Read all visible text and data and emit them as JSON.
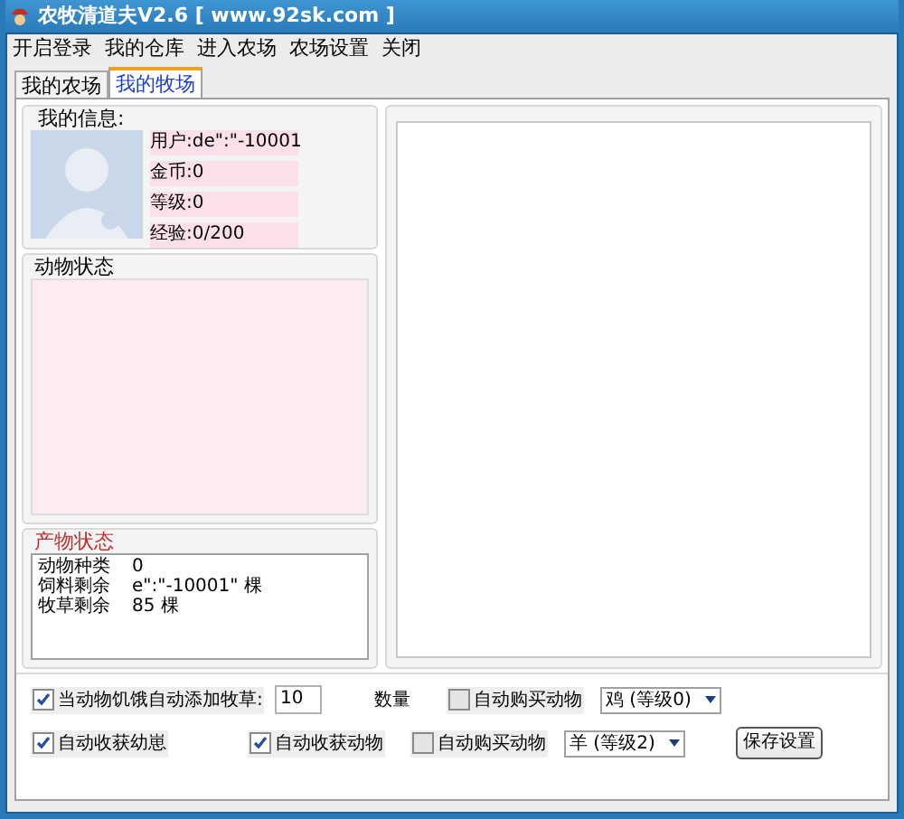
{
  "window": {
    "title": "农牧清道夫V2.6 [ www.92sk.com ]"
  },
  "menu": [
    "开启登录",
    "我的仓库",
    "进入农场",
    "农场设置",
    "关闭"
  ],
  "tabs": [
    {
      "label": "我的农场",
      "selected": false
    },
    {
      "label": "我的牧场",
      "selected": true
    }
  ],
  "my_info": {
    "title": "我的信息:",
    "fields": [
      "用户:de\":\"-10001",
      "金币:0",
      "等级:0",
      "经验:0/200"
    ]
  },
  "animal_status": {
    "title": "动物状态"
  },
  "product_status": {
    "title": "产物状态",
    "rows": [
      {
        "label": "动物种类",
        "value": "0"
      },
      {
        "label": "饲料剩余",
        "value": "e\":\"-10001\" 棵"
      },
      {
        "label": "牧草剩余",
        "value": "85 棵"
      }
    ]
  },
  "settings": {
    "row1": [
      {
        "kind": "checkbox",
        "label": "当动物饥饿自动添加牧草:",
        "checked": true
      },
      {
        "kind": "input",
        "value": "10"
      },
      {
        "kind": "label",
        "label": "数量"
      },
      {
        "kind": "checkbox",
        "label": "自动购买动物",
        "checked": false
      },
      {
        "kind": "select",
        "value": "鸡 (等级0)"
      }
    ],
    "row2": [
      {
        "kind": "checkbox",
        "label": "自动收获幼崽",
        "checked": true
      },
      {
        "kind": "checkbox",
        "label": "自动收获动物",
        "checked": true
      },
      {
        "kind": "checkbox",
        "label": "自动购买动物",
        "checked": false
      },
      {
        "kind": "select",
        "value": "羊 (等级2)"
      },
      {
        "kind": "button",
        "label": "保存设置"
      }
    ]
  }
}
